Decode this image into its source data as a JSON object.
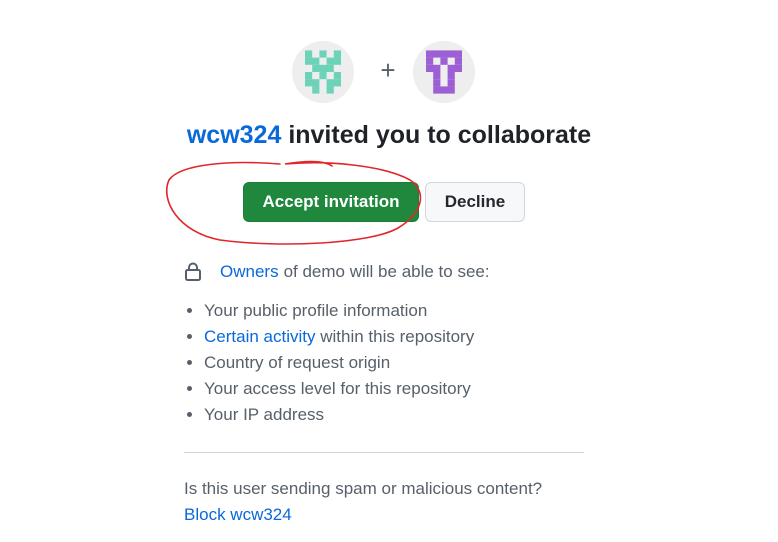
{
  "avatars": {
    "inviter_icon": "identicon-teal",
    "invitee_icon": "identicon-purple",
    "separator": "+"
  },
  "heading": {
    "inviter": "wcw324",
    "text": "invited you to collaborate"
  },
  "actions": {
    "accept_label": "Accept invitation",
    "decline_label": "Decline"
  },
  "visibility": {
    "lock_icon": "lock-icon",
    "owners_link": "Owners",
    "text": "of demo will be able to see:"
  },
  "permissions": [
    {
      "link": "",
      "text": "Your public profile information"
    },
    {
      "link": "Certain activity",
      "text": "within this repository"
    },
    {
      "link": "",
      "text": "Country of request origin"
    },
    {
      "link": "",
      "text": "Your access level for this repository"
    },
    {
      "link": "",
      "text": "Your IP address"
    }
  ],
  "spam": {
    "question": "Is this user sending spam or malicious content?",
    "block_link": "Block wcw324"
  },
  "colors": {
    "accept_bg": "#1f883d",
    "link": "#0969da",
    "annotation": "#e0262b",
    "identicon_teal": "#6cd3b8",
    "identicon_purple": "#9d5fd4"
  }
}
